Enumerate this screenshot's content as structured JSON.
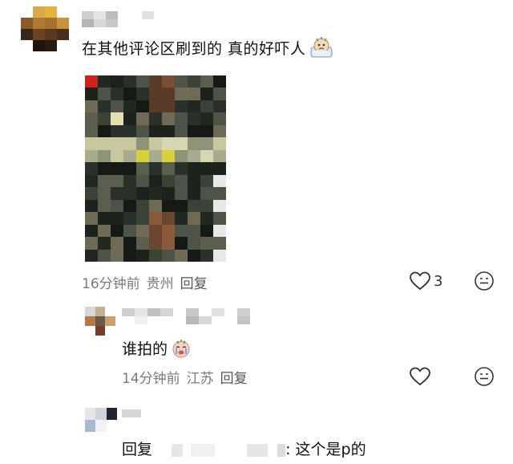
{
  "comment_main": {
    "text": "在其他评论区刷到的 真的好吓人",
    "time": "16分钟前",
    "location": "贵州",
    "reply_label": "回复",
    "like_count": "3"
  },
  "reply_1": {
    "text": "谁拍的",
    "time": "14分钟前",
    "location": "江苏",
    "reply_label": "回复"
  },
  "reply_2": {
    "prefix": "回复",
    "suffix": ": 这个是p的"
  },
  "colors": {
    "meta_text": "#7a7a7a",
    "body_text": "#111111",
    "icon_stroke": "#333333"
  },
  "icons": [
    "heart-outline-icon",
    "smile-emoji-icon",
    "crying-emoji-icon"
  ]
}
